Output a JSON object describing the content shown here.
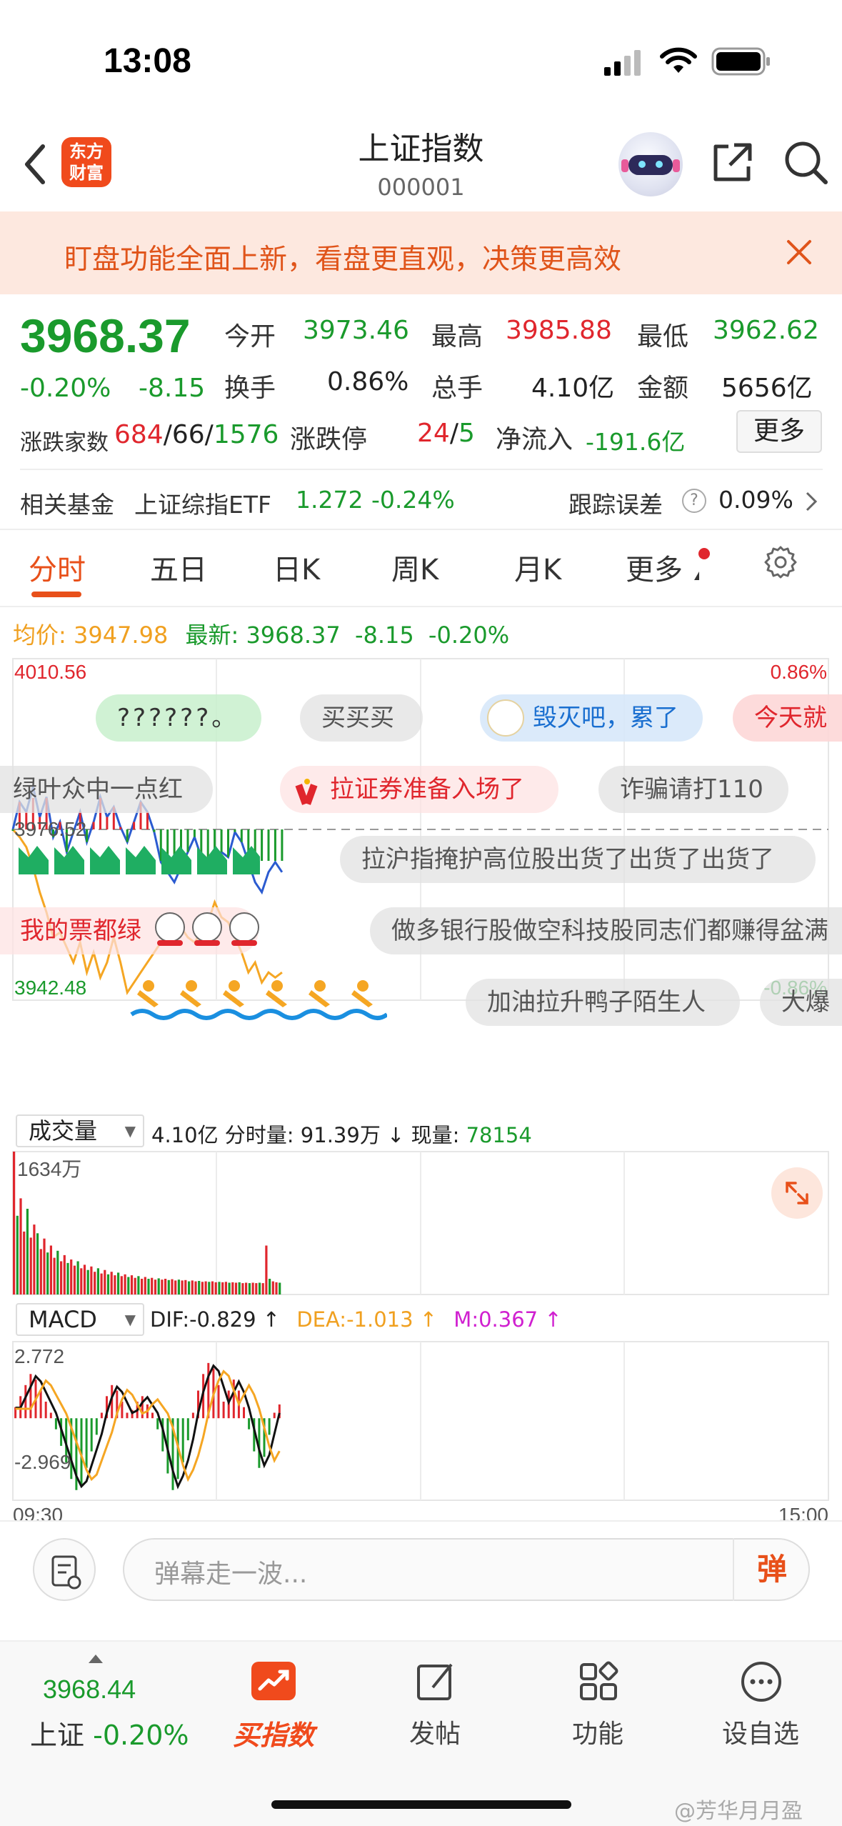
{
  "status_bar": {
    "time": "13:08"
  },
  "header": {
    "title": "上证指数",
    "code": "000001",
    "logo_line1": "东方",
    "logo_line2": "财富"
  },
  "banner": {
    "text": "盯盘功能全面上新，看盘更直观，决策更高效"
  },
  "quote": {
    "price": "3968.37",
    "change_pct": "-0.20%",
    "change_val": "-8.15",
    "open_label": "今开",
    "open": "3973.46",
    "high_label": "最高",
    "high": "3985.88",
    "low_label": "最低",
    "low": "3962.62",
    "turnover_label": "换手",
    "turnover": "0.86%",
    "volume_label": "总手",
    "volume": "4.10亿",
    "amount_label": "金额",
    "amount": "5656亿",
    "breadth_label": "涨跌家数",
    "up_count": "684",
    "flat_count": "66",
    "down_count": "1576",
    "sep": "/",
    "limit_label": "涨跌停",
    "limit_up": "24",
    "limit_down": "5",
    "netflow_label": "净流入",
    "netflow": "-191.6亿",
    "more_label": "更多"
  },
  "fund": {
    "label": "相关基金",
    "name": "上证综指ETF",
    "price": "1.272",
    "chg": "-0.24%",
    "error_label": "跟踪误差",
    "error": "0.09%",
    "help": "?"
  },
  "tabs": [
    "分时",
    "五日",
    "日K",
    "周K",
    "月K",
    "更多"
  ],
  "chart_info": {
    "avg_label": "均价:",
    "avg": "3947.98",
    "latest_label": "最新:",
    "latest": "3968.37",
    "latest_chg": "-8.15",
    "latest_pct": "-0.20%",
    "y_top": "4010.56",
    "y_mid": "3976.52",
    "y_bottom": "3942.48",
    "pct_top": "0.86%",
    "pct_bottom": "-0.86%",
    "vol_select": "成交量",
    "vol_total": "4.10亿",
    "vol_fen_label": "分时量:",
    "vol_fen": "91.39万",
    "vol_now_label": "现量:",
    "vol_now": "78154",
    "vol_max": "1634万",
    "macd_select": "MACD",
    "dif": "DIF:-0.829 ↑",
    "dea": "DEA:-1.013 ↑",
    "m": "M:0.367 ↑",
    "macd_top": "2.772",
    "macd_bottom": "-2.969",
    "time_start": "09:30",
    "time_end": "15:00"
  },
  "danmaku": [
    "??????。",
    "买买买",
    "毁灭吧，累了",
    "今天就",
    "绿叶众中一点红",
    "拉证券准备入场了",
    "诈骗请打110",
    "拉沪指掩护高位股出货了出货了出货了",
    "我的票都绿",
    "做多银行股做空科技股同志们都赚得盆满",
    "加油拉升鸭子陌生人",
    "大爆"
  ],
  "comment": {
    "placeholder": "弹幕走一波...",
    "dan_label": "弹"
  },
  "bottom_nav": {
    "price": "3968.44",
    "index_name": "上证",
    "index_chg": "-0.20%",
    "items": [
      "买指数",
      "发帖",
      "功能",
      "设自选"
    ]
  },
  "watermark": "@芳华月月盈",
  "chart_data": [
    {
      "type": "line",
      "title": "",
      "x_range": [
        "09:30",
        "15:00"
      ],
      "ylim": [
        3942.48,
        4010.56
      ],
      "y_reference": 3976.52,
      "series": [
        {
          "name": "最新",
          "values": [
            3976.5,
            3982,
            3980,
            3985,
            3979,
            3983,
            3975,
            3978,
            3972,
            3976,
            3980,
            3974,
            3978,
            3983,
            3979,
            3981,
            3977,
            3974,
            3978,
            3982,
            3980,
            3976,
            3970,
            3968,
            3966,
            3969,
            3972,
            3975,
            3971,
            3970,
            3968,
            3972,
            3971,
            3976,
            3974,
            3970,
            3966,
            3964,
            3968,
            3970,
            3968
          ]
        },
        {
          "name": "均价",
          "values": [
            3976.5,
            3975,
            3973,
            3969,
            3964,
            3960,
            3955,
            3956,
            3953,
            3950,
            3954,
            3948,
            3952,
            3947,
            3950,
            3955,
            3950,
            3944,
            3946,
            3948,
            3950,
            3952,
            3954,
            3956,
            3958,
            3957,
            3955,
            3954,
            3956,
            3958,
            3962,
            3959,
            3958,
            3955,
            3952,
            3948,
            3950,
            3946,
            3948,
            3947,
            3948
          ]
        }
      ]
    },
    {
      "type": "bar",
      "title": "成交量",
      "ylim": [
        0,
        1634
      ],
      "values": [
        1634,
        900,
        1100,
        720,
        980,
        650,
        800,
        700,
        520,
        640,
        480,
        560,
        420,
        500,
        380,
        450,
        360,
        400,
        330,
        380,
        300,
        340,
        280,
        320,
        260,
        300,
        240,
        280,
        230,
        260,
        220,
        250,
        210,
        230,
        200,
        220,
        190,
        210,
        180,
        200,
        180,
        190,
        170,
        185,
        170,
        180,
        165,
        175,
        160,
        170,
        160,
        165,
        150,
        160,
        150,
        155,
        145,
        150,
        145,
        150,
        140,
        145,
        140,
        145,
        135,
        140,
        135,
        140,
        130,
        135,
        130,
        135,
        130,
        135,
        130,
        560,
        180,
        150,
        140,
        135
      ]
    },
    {
      "type": "bar",
      "title": "MACD",
      "ylim": [
        -2.969,
        2.772
      ],
      "values": [
        0.4,
        0.8,
        1.2,
        1.6,
        1.4,
        1.0,
        0.6,
        0.2,
        -0.4,
        -1.0,
        -1.6,
        -2.2,
        -2.6,
        -2.4,
        -1.8,
        -1.2,
        -0.6,
        0.2,
        0.8,
        1.2,
        1.0,
        0.6,
        0.2,
        0.3,
        0.6,
        0.8,
        0.5,
        0.2,
        -0.4,
        -1.2,
        -2.0,
        -2.6,
        -2.2,
        -1.6,
        -0.8,
        0.2,
        1.0,
        1.6,
        2.0,
        1.8,
        1.2,
        0.6,
        1.0,
        1.4,
        1.0,
        0.4,
        -0.4,
        -1.2,
        -1.8,
        -1.4,
        -0.6,
        0.2,
        0.5
      ]
    }
  ]
}
